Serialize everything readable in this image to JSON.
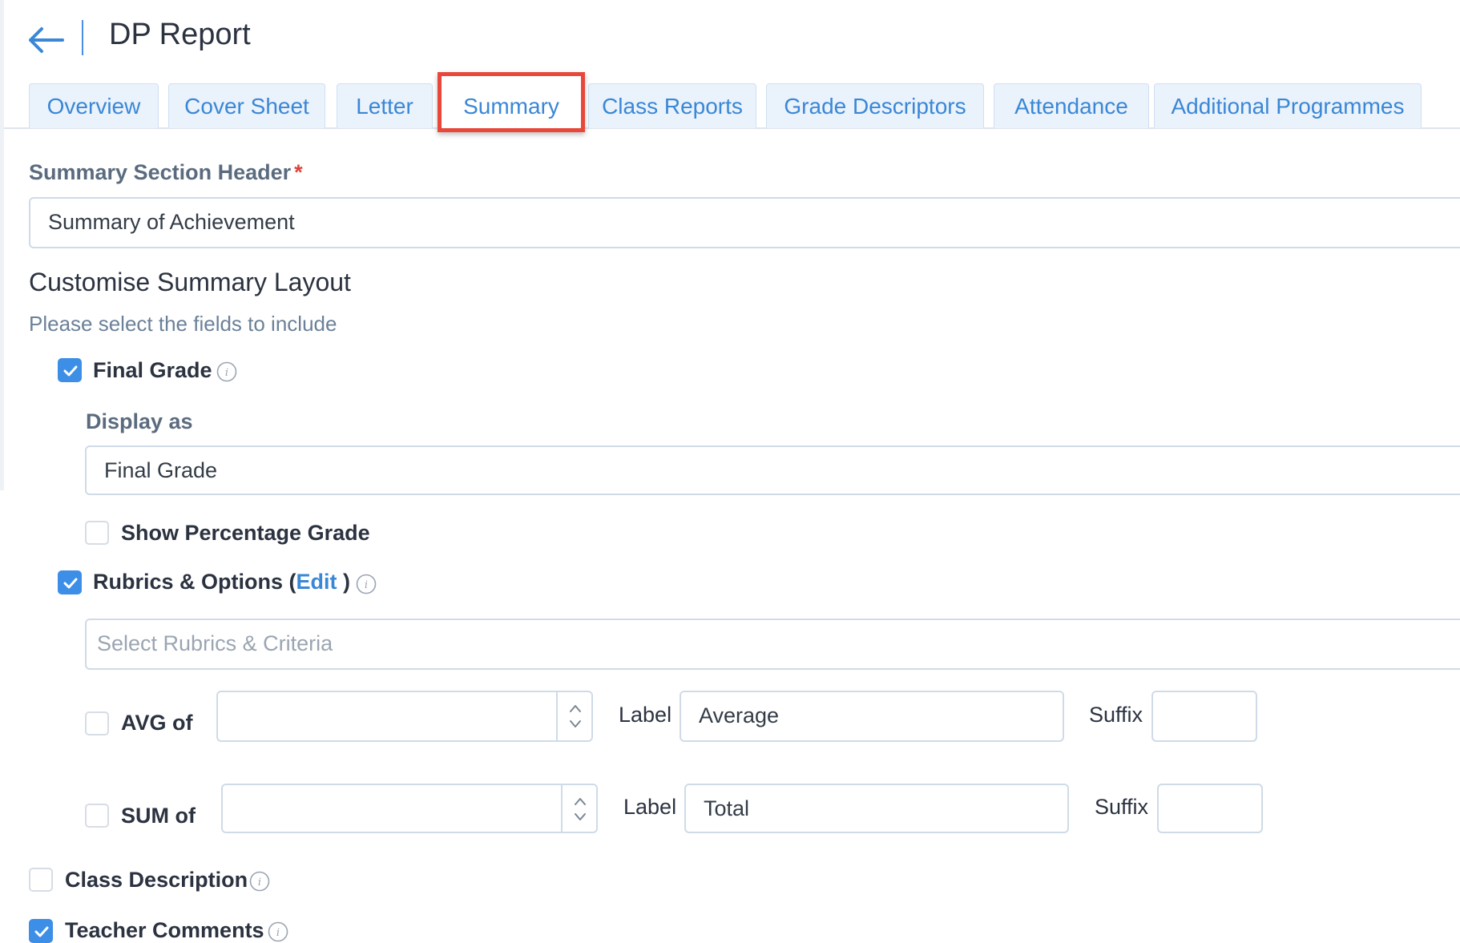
{
  "header": {
    "title": "DP Report"
  },
  "tabs": [
    {
      "label": "Overview"
    },
    {
      "label": "Cover Sheet"
    },
    {
      "label": "Letter"
    },
    {
      "label": "Summary"
    },
    {
      "label": "Class Reports"
    },
    {
      "label": "Grade Descriptors"
    },
    {
      "label": "Attendance"
    },
    {
      "label": "Additional Programmes"
    }
  ],
  "active_tab": "Summary",
  "form": {
    "section_header_label": "Summary Section Header",
    "required_mark": "*",
    "section_header_value": "Summary of Achievement",
    "layout_title": "Customise Summary Layout",
    "layout_help": "Please select the fields to include",
    "final_grade": {
      "label": "Final Grade",
      "checked": true,
      "display_as_label": "Display as",
      "display_as_value": "Final Grade"
    },
    "show_percentage": {
      "label": "Show Percentage Grade",
      "checked": false
    },
    "rubrics": {
      "label_prefix": "Rubrics & Options (",
      "edit_label": "Edit",
      "label_suffix": " )",
      "checked": true,
      "select_placeholder": "Select Rubrics & Criteria"
    },
    "avg": {
      "checkbox_label": "AVG of",
      "checked": false,
      "value": "",
      "label_caption": "Label",
      "label_value": "Average",
      "suffix_caption": "Suffix",
      "suffix_value": ""
    },
    "sum": {
      "checkbox_label": "SUM of",
      "checked": false,
      "value": "",
      "label_caption": "Label",
      "label_value": "Total",
      "suffix_caption": "Suffix",
      "suffix_value": ""
    },
    "class_description": {
      "label": "Class Description",
      "checked": false
    },
    "teacher_comments": {
      "label": "Teacher Comments",
      "checked": true
    }
  },
  "colors": {
    "accent": "#3d8ee6",
    "tab_text": "#3a87d6",
    "highlight_box": "#e8473a",
    "required": "#e0403a"
  }
}
